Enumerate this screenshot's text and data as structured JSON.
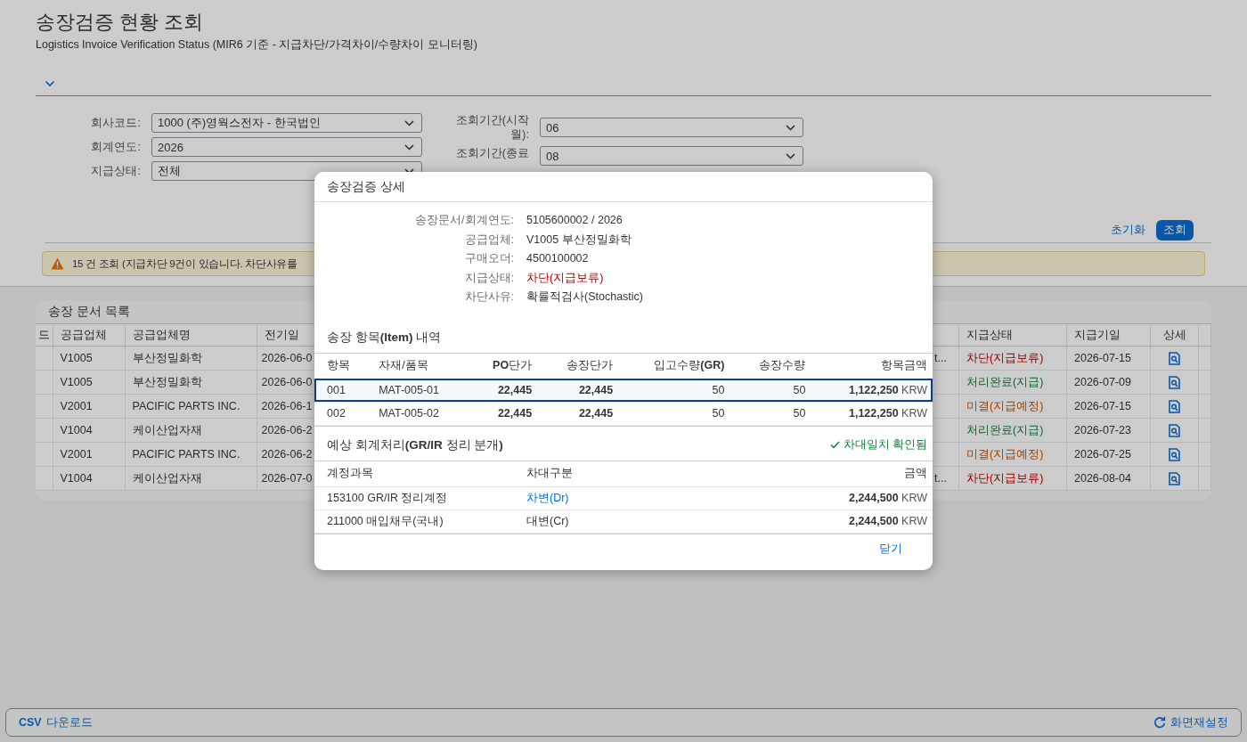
{
  "page": {
    "title": "송장검증 현황 조회",
    "subtitle": "Logistics Invoice Verification Status (MIR6 기준 - 지급차단/가격차이/수량차이 모니터링)"
  },
  "filters_left": [
    {
      "label": "회사코드:",
      "value": "1000 (주)영웍스전자 - 한국법인"
    },
    {
      "label": "회계연도:",
      "value": "2026"
    },
    {
      "label": "지급상태:",
      "value": "전체"
    }
  ],
  "filters_right": [
    {
      "label": "조회기간(시작월):",
      "value": "06"
    },
    {
      "label": "조회기간(종료",
      "value": "08"
    }
  ],
  "actions": {
    "reset": "초기화",
    "search": "조회"
  },
  "message": {
    "text": "15 건 조회 (지급차단 9건이 있습니다. 차단사유를"
  },
  "table": {
    "title": "송장 문서 목록",
    "columns": [
      "드",
      "공급업체",
      "공급업체명",
      "전기일",
      "지급상태",
      "지급기일",
      "상세"
    ],
    "rows": [
      {
        "vendor": "V1005",
        "vendor_name": "부산정밀화학",
        "posting_date": "2026-06-0",
        "column_5": "t...",
        "status": "차단(지급보류)",
        "kind": "blocked",
        "due_date": "2026-07-15"
      },
      {
        "vendor": "V1005",
        "vendor_name": "부산정밀화학",
        "posting_date": "2026-06-0",
        "status": "처리완료(지급)",
        "kind": "paid",
        "due_date": "2026-07-09"
      },
      {
        "vendor": "V2001",
        "vendor_name": "PACIFIC PARTS INC.",
        "posting_date": "2026-06-1",
        "status": "미결(지급예정)",
        "kind": "pending",
        "due_date": "2026-07-15"
      },
      {
        "vendor": "V1004",
        "vendor_name": "케이산업자재",
        "posting_date": "2026-06-2",
        "status": "처리완료(지급)",
        "kind": "paid",
        "due_date": "2026-07-23"
      },
      {
        "vendor": "V2001",
        "vendor_name": "PACIFIC PARTS INC.",
        "posting_date": "2026-06-2",
        "status": "미결(지급예정)",
        "kind": "pending",
        "due_date": "2026-07-25"
      },
      {
        "vendor": "V1004",
        "vendor_name": "케이산업자재",
        "posting_date": "2026-07-0",
        "column_5": "t...",
        "status": "차단(지급보류)",
        "kind": "blocked",
        "due_date": "2026-08-04"
      }
    ]
  },
  "dialog": {
    "title": "송장검증 상세",
    "fields": [
      {
        "label": "송장문서/회계연도:",
        "value": "5105600002 / 2026",
        "kind": "plain"
      },
      {
        "label": "공급업체:",
        "value": "V1005 부산정밀화학",
        "kind": "plain"
      },
      {
        "label": "구매오더:",
        "value": "4500100002",
        "kind": "plain"
      },
      {
        "label": "지급상태:",
        "value": "차단(지급보류)",
        "kind": "blocked"
      },
      {
        "label": "차단사유:",
        "value": "확률적검사(Stochastic)",
        "kind": "plain"
      }
    ],
    "items": {
      "title": "송장 항목**(Item)** 내역",
      "columns": [
        "항목",
        "자재/품목",
        "**PO**단가",
        "송장단가",
        "입고수량**(GR)**",
        "송장수량",
        "항목금액"
      ],
      "rows": [
        {
          "item": "001",
          "material": "MAT-005-01",
          "po_price": "22,445",
          "invoice_price": "22,445",
          "gr_qty": "50",
          "invoice_qty": "50",
          "amount": "1,122,250",
          "currency": "KRW",
          "selected": true
        },
        {
          "item": "002",
          "material": "MAT-005-02",
          "po_price": "22,445",
          "invoice_price": "22,445",
          "gr_qty": "50",
          "invoice_qty": "50",
          "amount": "1,122,250",
          "currency": "KRW",
          "selected": false
        }
      ]
    },
    "accounting": {
      "title": "예상 회계처리**(GR/IR** 정리 분개**)**",
      "balance_status": "차대일치 확인됨",
      "columns": [
        "계정과목",
        "차대구분",
        "금액"
      ],
      "rows": [
        {
          "account": "153100 GR/IR 정리계정",
          "side": "차변(Dr)",
          "kind": "debit",
          "amount": "2,244,500",
          "currency": "KRW"
        },
        {
          "account": "211000 매입채무(국내)",
          "side": "대변(Cr)",
          "kind": "credit",
          "amount": "2,244,500",
          "currency": "KRW"
        }
      ]
    },
    "close": "닫기"
  },
  "footer": {
    "download": "**CSV** 다운로드",
    "reset_layout": "화면재설정"
  }
}
